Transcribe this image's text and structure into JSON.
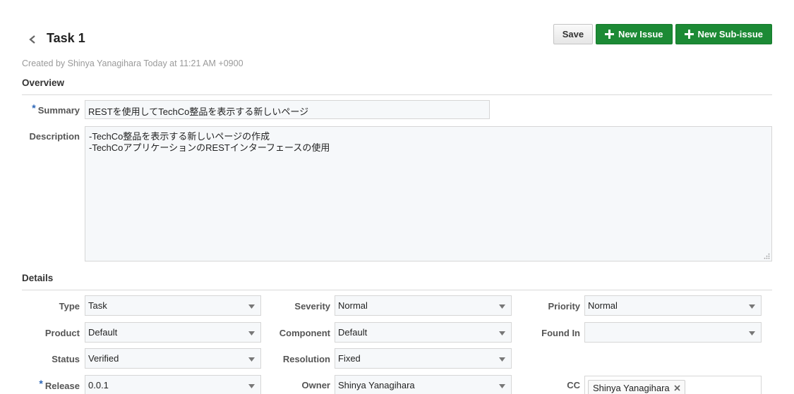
{
  "header": {
    "title": "Task 1",
    "created": "Created by Shinya Yanagihara Today at 11:21 AM +0900",
    "save_label": "Save",
    "new_issue_label": "New Issue",
    "new_subissue_label": "New Sub-issue"
  },
  "overview": {
    "title": "Overview",
    "summary_label": "Summary",
    "summary_value": "RESTを使用してTechCo整品を表示する新しいページ",
    "description_label": "Description",
    "description_lines": [
      "-TechCo整品を表示する新しいページの作成",
      "-TechCoアプリケーションのRESTインターフェースの使用"
    ]
  },
  "details": {
    "title": "Details",
    "type": {
      "label": "Type",
      "value": "Task"
    },
    "severity": {
      "label": "Severity",
      "value": "Normal"
    },
    "priority": {
      "label": "Priority",
      "value": "Normal"
    },
    "product": {
      "label": "Product",
      "value": "Default"
    },
    "component": {
      "label": "Component",
      "value": "Default"
    },
    "found_in": {
      "label": "Found In",
      "value": ""
    },
    "status": {
      "label": "Status",
      "value": "Verified"
    },
    "resolution": {
      "label": "Resolution",
      "value": "Fixed"
    },
    "release": {
      "label": "Release",
      "value": "0.0.1"
    },
    "owner": {
      "label": "Owner",
      "value": "Shinya Yanagihara"
    },
    "cc": {
      "label": "CC",
      "chips": [
        "Shinya Yanagihara"
      ]
    }
  },
  "colors": {
    "accent_green": "#1c8a35",
    "required_marker": "#2c66b8"
  },
  "icons": [
    "back-chevron-icon",
    "plus-icon",
    "caret-down-icon",
    "remove-x-icon",
    "resize-grip-icon"
  ]
}
